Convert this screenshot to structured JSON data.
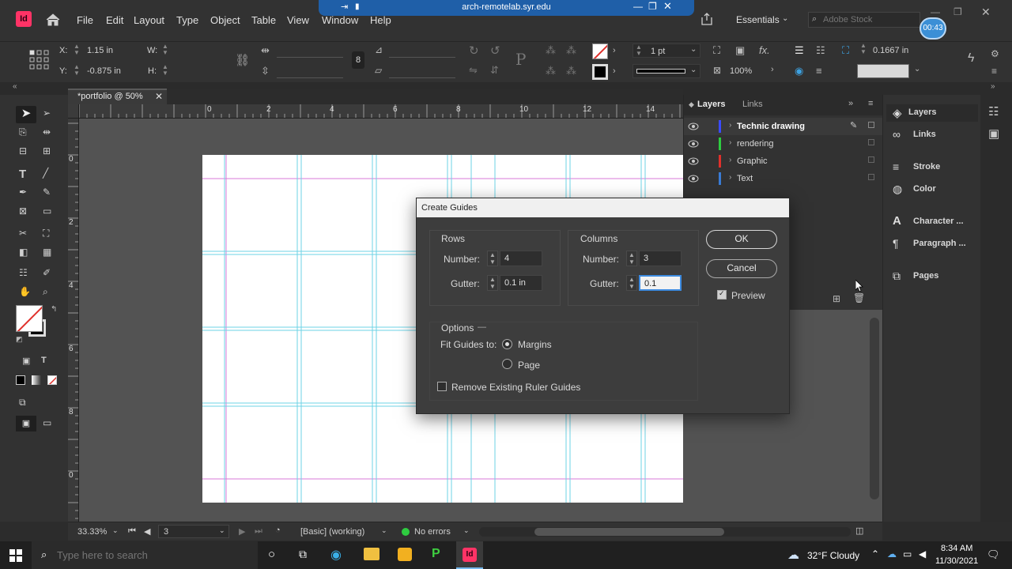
{
  "app": {
    "logo_text": "Id",
    "brand_color": "#ff3366",
    "accent_color": "#3da1e0"
  },
  "menubar": {
    "items": [
      "File",
      "Edit",
      "Layout",
      "Type",
      "Object",
      "Table",
      "View",
      "Window",
      "Help"
    ],
    "remote_title": "arch-remotelab.syr.edu",
    "workspace": "Essentials",
    "search_placeholder": "Adobe Stock",
    "timer": "00:43"
  },
  "control": {
    "x_label": "X:",
    "x_value": "1.15 in",
    "y_label": "Y:",
    "y_value": "-0.875 in",
    "w_label": "W:",
    "h_label": "H:",
    "stroke_weight": "1 pt",
    "opacity": "100%",
    "offset": "0.1667 in"
  },
  "document": {
    "tab_title": "*portfolio @ 50%"
  },
  "ruler": {
    "top_labels": [
      "0",
      "2",
      "4",
      "6",
      "8",
      "10",
      "12",
      "14"
    ],
    "left_labels": [
      "0",
      "2",
      "4",
      "6",
      "8",
      "0"
    ]
  },
  "layers_panel": {
    "tabs": [
      "Layers",
      "Links"
    ],
    "layers": [
      {
        "name": "Technic drawing",
        "color": "#3a4bff",
        "selected": true
      },
      {
        "name": "rendering",
        "color": "#2ecc40"
      },
      {
        "name": "Graphic",
        "color": "#e0302b"
      },
      {
        "name": "Text",
        "color": "#3a7bd5"
      }
    ]
  },
  "dock": {
    "items": [
      "Layers",
      "Links",
      "Stroke",
      "Color",
      "Character ...",
      "Paragraph ...",
      "Pages"
    ]
  },
  "dialog": {
    "title": "Create Guides",
    "rows_heading": "Rows",
    "rows_number_label": "Number:",
    "rows_number": "4",
    "rows_gutter_label": "Gutter:",
    "rows_gutter": "0.1 in",
    "columns_heading": "Columns",
    "columns_number_label": "Number:",
    "columns_number": "3",
    "columns_gutter_label": "Gutter:",
    "columns_gutter": "0.1",
    "ok": "OK",
    "cancel": "Cancel",
    "preview": "Preview",
    "preview_checked": true,
    "options_heading": "Options",
    "fit_label": "Fit Guides to:",
    "fit_margins": "Margins",
    "fit_page": "Page",
    "fit_selected": "Margins",
    "remove_label": "Remove Existing Ruler Guides",
    "remove_checked": false
  },
  "status": {
    "zoom": "33.33%",
    "page": "3",
    "profile": "[Basic] (working)",
    "errors": "No errors"
  },
  "taskbar": {
    "search_placeholder": "Type here to search",
    "weather": "32°F  Cloudy",
    "time": "8:34 AM",
    "date": "11/30/2021"
  }
}
